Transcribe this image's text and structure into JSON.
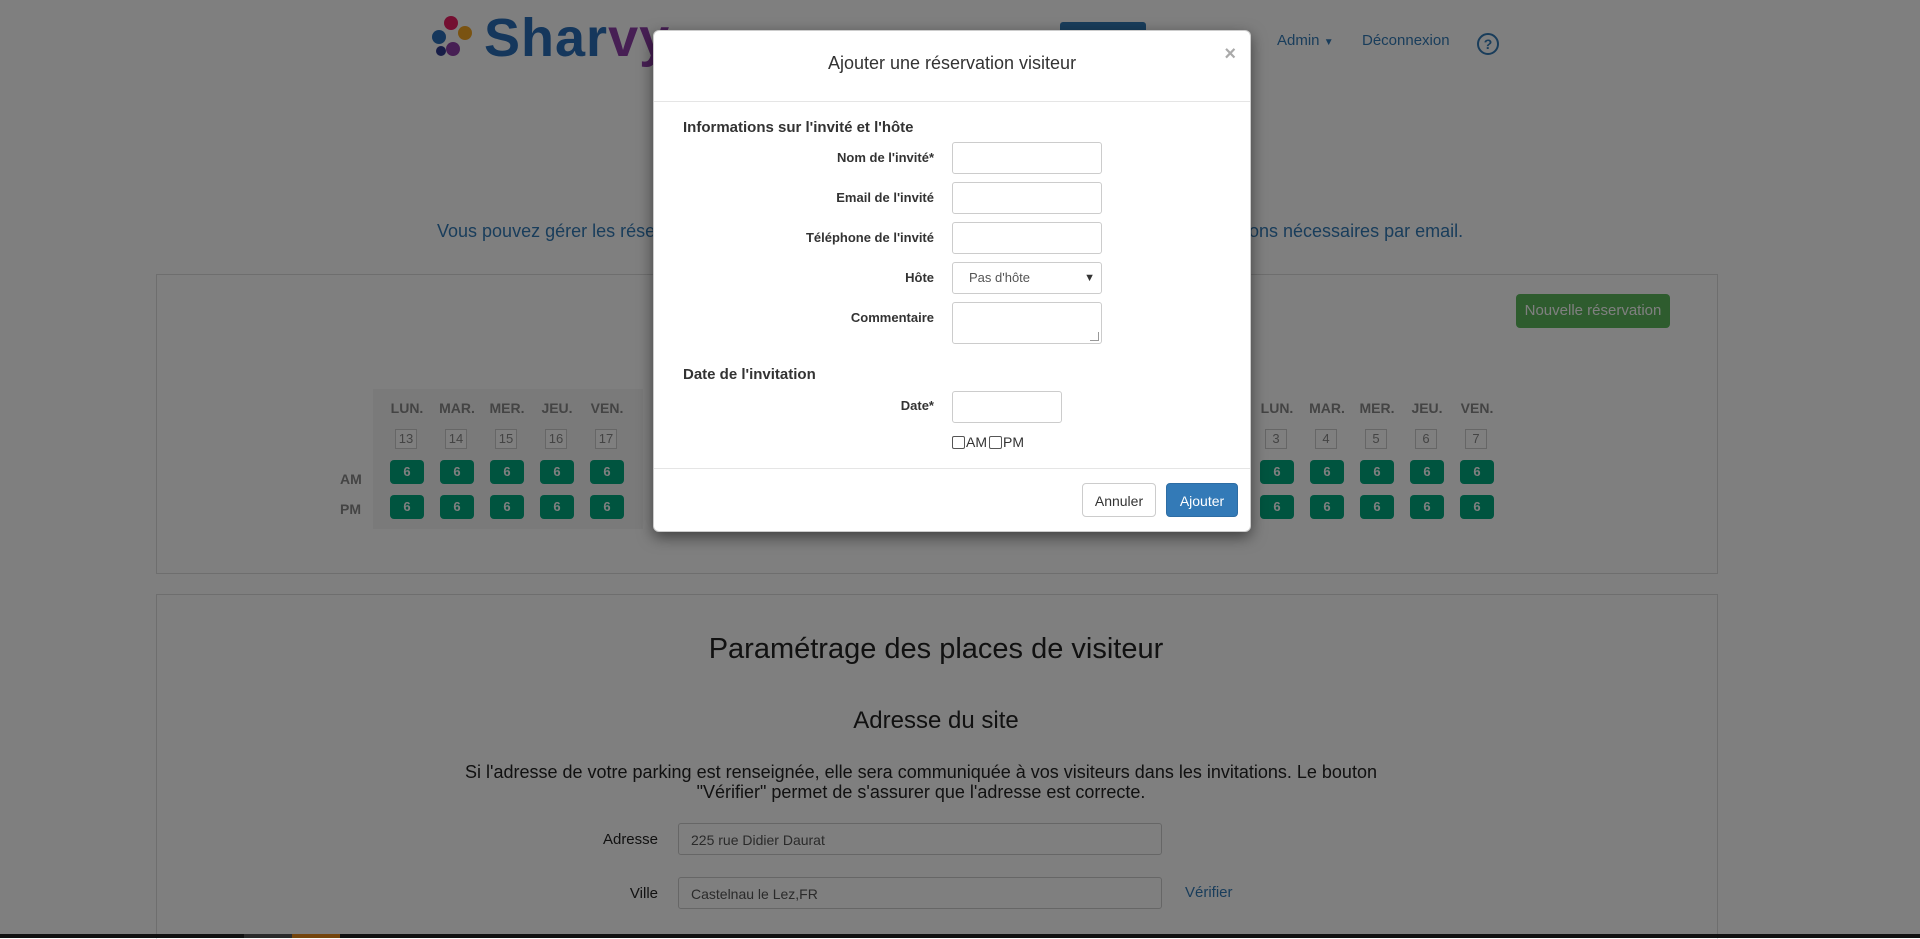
{
  "header": {
    "logo_text_a": "Shar",
    "logo_text_b": "vy",
    "nav_admin": "Admin",
    "nav_logout": "Déconnexion",
    "nav_help": "?"
  },
  "intro": {
    "left": "Vous pouvez gérer les rése",
    "right": "ons nécessaires par email."
  },
  "calendar": {
    "new_reservation": "Nouvelle réservation",
    "am_label": "AM",
    "pm_label": "PM",
    "week1": {
      "days": [
        "LUN.",
        "MAR.",
        "MER.",
        "JEU.",
        "VEN."
      ],
      "dates": [
        "13",
        "14",
        "15",
        "16",
        "17"
      ],
      "am": [
        "6",
        "6",
        "6",
        "6",
        "6"
      ],
      "pm": [
        "6",
        "6",
        "6",
        "6",
        "6"
      ]
    },
    "week2": {
      "days": [
        "LUN.",
        "MAR.",
        "MER.",
        "JEU.",
        "VEN."
      ],
      "dates": [
        "3",
        "4",
        "5",
        "6",
        "7"
      ],
      "am": [
        "6",
        "6",
        "6",
        "6",
        "6"
      ],
      "pm": [
        "6",
        "6",
        "6",
        "6",
        "6"
      ]
    }
  },
  "settings": {
    "title": "Paramétrage des places de visiteur",
    "subtitle": "Adresse du site",
    "description_line1": "Si l'adresse de votre parking est renseignée, elle sera communiquée à vos visiteurs dans les invitations. Le bouton",
    "description_line2": "\"Vérifier\" permet de s'assurer que l'adresse est correcte.",
    "address_label": "Adresse",
    "address_value": "225 rue Didier Daurat",
    "city_label": "Ville",
    "city_value": "Castelnau le Lez,FR",
    "verify_link": "Vérifier"
  },
  "modal": {
    "title": "Ajouter une réservation visiteur",
    "close": "×",
    "section_guest": "Informations sur l'invité et l'hôte",
    "guest_name_label": "Nom de l'invité*",
    "guest_email_label": "Email de l'invité",
    "guest_phone_label": "Téléphone de l'invité",
    "host_label": "Hôte",
    "host_value": "Pas d'hôte",
    "comment_label": "Commentaire",
    "section_date": "Date de l'invitation",
    "date_label": "Date*",
    "am_option": "AM",
    "pm_option": "PM",
    "cancel_button": "Annuler",
    "add_button": "Ajouter"
  }
}
